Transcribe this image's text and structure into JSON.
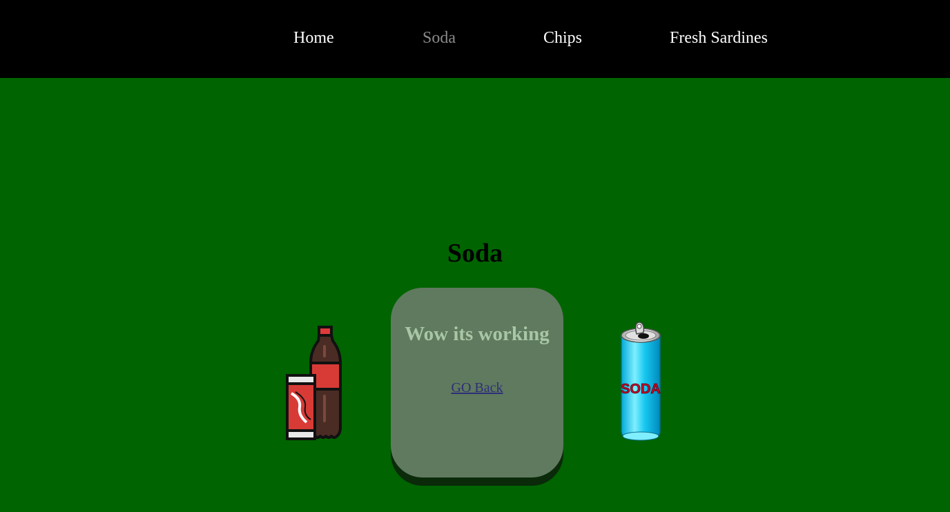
{
  "nav": {
    "items": [
      {
        "label": "Home",
        "active": false
      },
      {
        "label": "Soda",
        "active": true
      },
      {
        "label": "Chips",
        "active": false
      },
      {
        "label": "Fresh Sardines",
        "active": false
      }
    ]
  },
  "main": {
    "title": "Soda",
    "card": {
      "heading": "Wow its working",
      "link_label": "GO Back"
    },
    "images": {
      "left_icon": "cola-bottle-and-can-icon",
      "right_icon": "blue-soda-can-icon",
      "can_label": "SODA"
    }
  },
  "colors": {
    "page_background": "#006400",
    "navbar_background": "#000000",
    "nav_text": "#ffffff",
    "nav_active_text": "#8a8a8a",
    "card_background": "#5f7a5e",
    "card_heading": "#a9c7a6",
    "link": "#2e2e78"
  }
}
